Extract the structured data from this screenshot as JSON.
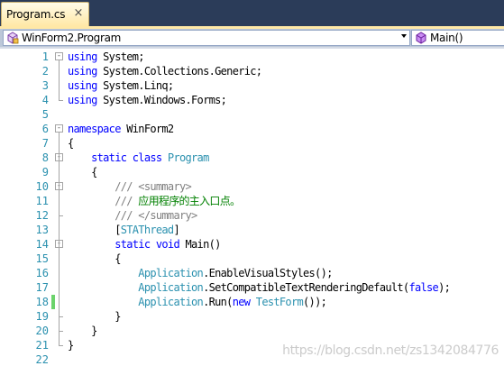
{
  "tab": {
    "title": "Program.cs",
    "close_glyph": "×"
  },
  "nav": {
    "class_dropdown": {
      "value": "WinForm2.Program",
      "icon": "class-icon"
    },
    "member_dropdown": {
      "value": "Main()",
      "icon": "method-icon"
    }
  },
  "colors": {
    "keyword": "#0000ff",
    "type": "#2b91af",
    "comment": "#008000",
    "line_number": "#2b91af",
    "changed_saved": "#6bd36b",
    "changed_unsaved": "#f5e37a"
  },
  "editor": {
    "lines": [
      {
        "num": "1",
        "parts": [
          [
            "kw",
            "using"
          ],
          [
            "",
            "System;"
          ]
        ]
      },
      {
        "num": "2",
        "parts": [
          [
            "kw",
            "using"
          ],
          [
            "",
            "System.Collections.Generic;"
          ]
        ]
      },
      {
        "num": "3",
        "parts": [
          [
            "kw",
            "using"
          ],
          [
            "",
            "System.Linq;"
          ]
        ]
      },
      {
        "num": "4",
        "parts": [
          [
            "kw",
            "using"
          ],
          [
            "",
            "System.Windows.Forms;"
          ]
        ]
      },
      {
        "num": "5",
        "parts": []
      },
      {
        "num": "6",
        "parts": [
          [
            "kw",
            "namespace"
          ],
          [
            "",
            " WinForm2"
          ]
        ]
      },
      {
        "num": "7",
        "parts": [
          [
            "",
            "{"
          ]
        ]
      },
      {
        "num": "8",
        "parts": [
          [
            "",
            "    "
          ],
          [
            "kw",
            "static class"
          ],
          [
            "",
            ""
          ],
          [
            "ty",
            " Program"
          ]
        ]
      },
      {
        "num": "9",
        "parts": [
          [
            "",
            "    {"
          ]
        ]
      },
      {
        "num": "10",
        "parts": [
          [
            "",
            "        "
          ],
          [
            "dc",
            "///"
          ],
          [
            "dc",
            " <summary>"
          ]
        ]
      },
      {
        "num": "11",
        "parts": [
          [
            "",
            "        "
          ],
          [
            "dc",
            "///"
          ],
          [
            "cm",
            " 应用程序的主入口点。"
          ]
        ]
      },
      {
        "num": "12",
        "parts": [
          [
            "",
            "        "
          ],
          [
            "dc",
            "///"
          ],
          [
            "dc",
            " </summary>"
          ]
        ]
      },
      {
        "num": "13",
        "parts": [
          [
            "",
            "        ["
          ],
          [
            "ty",
            "STAThread"
          ],
          [
            "",
            "]"
          ]
        ]
      },
      {
        "num": "14",
        "parts": [
          [
            "",
            "        "
          ],
          [
            "kw",
            "static void"
          ],
          [
            "",
            " Main()"
          ]
        ]
      },
      {
        "num": "15",
        "parts": [
          [
            "",
            "        {"
          ]
        ]
      },
      {
        "num": "16",
        "parts": [
          [
            "",
            "            "
          ],
          [
            "ty",
            "Application"
          ],
          [
            "",
            ".EnableVisualStyles();"
          ]
        ]
      },
      {
        "num": "17",
        "parts": [
          [
            "",
            "            "
          ],
          [
            "ty",
            "Application"
          ],
          [
            "",
            ".SetCompatibleTextRenderingDefault("
          ],
          [
            "kw",
            "false"
          ],
          [
            "",
            ");"
          ]
        ]
      },
      {
        "num": "18",
        "parts": [
          [
            "",
            "            "
          ],
          [
            "ty",
            "Application"
          ],
          [
            "",
            ".Run("
          ],
          [
            "kw",
            "new"
          ],
          [
            "ty",
            " TestForm"
          ],
          [
            "",
            "());"
          ]
        ]
      },
      {
        "num": "19",
        "parts": [
          [
            "",
            "        }"
          ]
        ]
      },
      {
        "num": "20",
        "parts": [
          [
            "",
            "    }"
          ]
        ]
      },
      {
        "num": "21",
        "parts": [
          [
            "",
            "}"
          ]
        ]
      },
      {
        "num": "22",
        "parts": []
      }
    ],
    "changed_lines": [
      "18"
    ]
  },
  "watermark": "https://blog.csdn.net/zs1342084776"
}
